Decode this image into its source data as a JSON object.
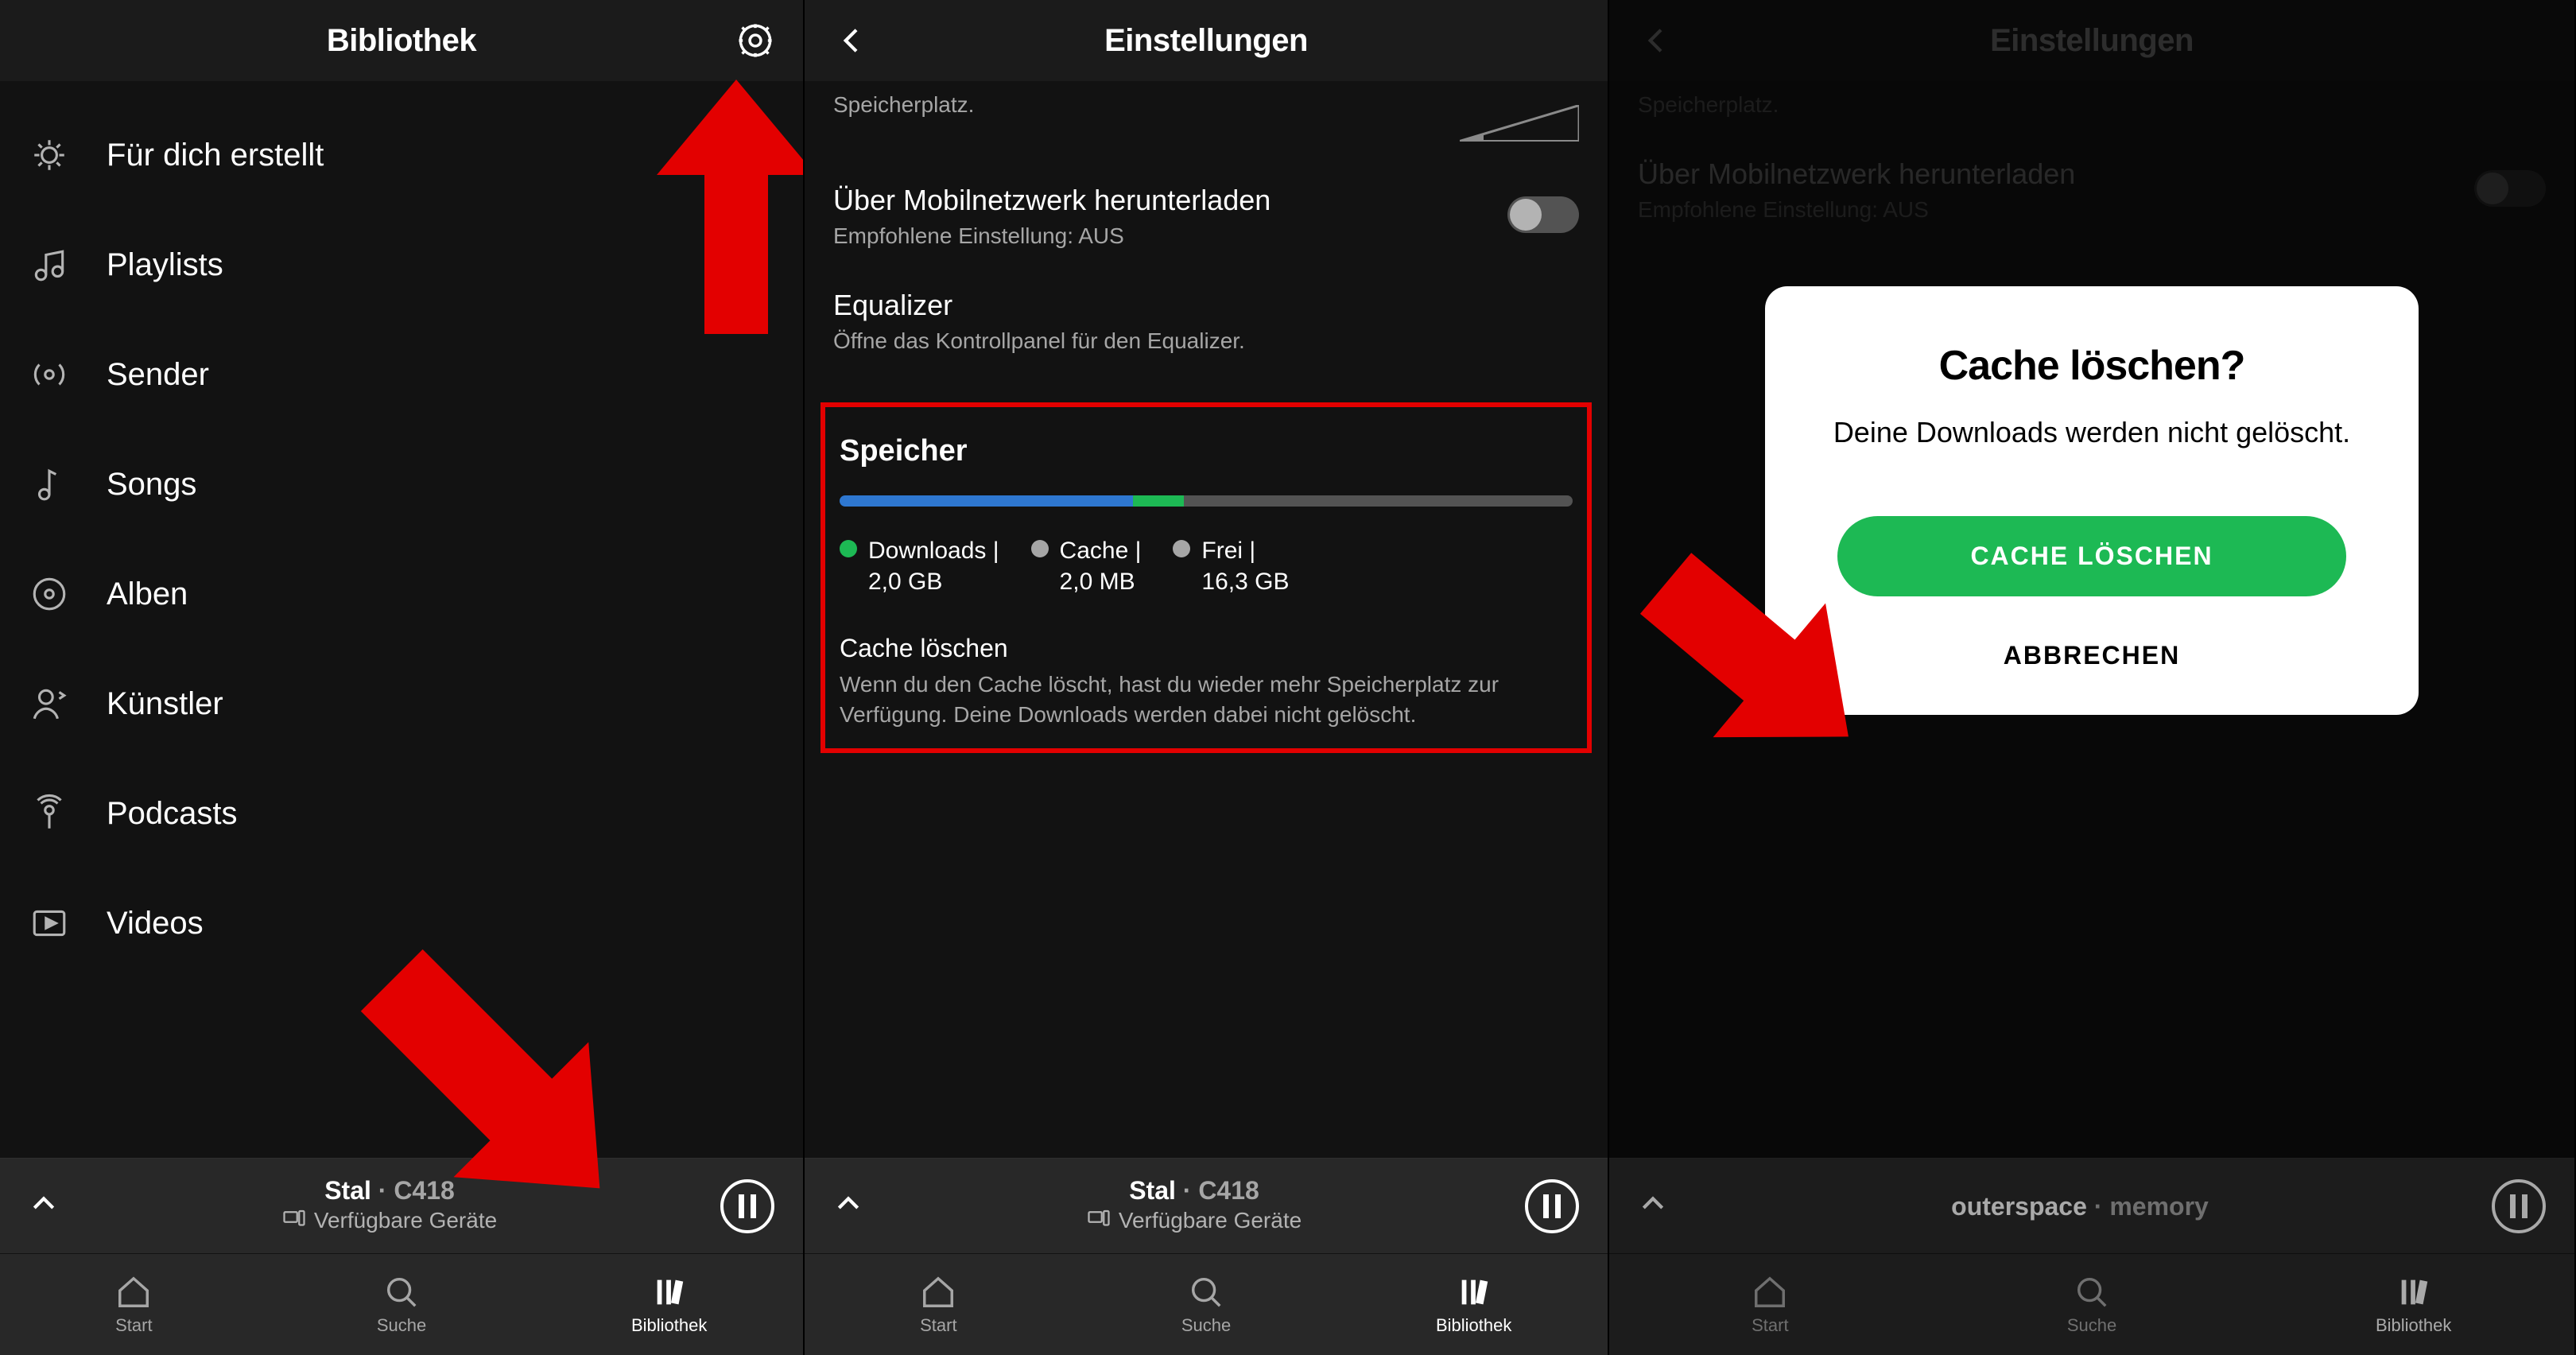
{
  "library": {
    "title": "Bibliothek",
    "items": [
      {
        "icon": "made-for-you",
        "label": "Für dich erstellt"
      },
      {
        "icon": "playlist",
        "label": "Playlists"
      },
      {
        "icon": "radio",
        "label": "Sender"
      },
      {
        "icon": "note",
        "label": "Songs"
      },
      {
        "icon": "album",
        "label": "Alben"
      },
      {
        "icon": "artist",
        "label": "Künstler"
      },
      {
        "icon": "podcast",
        "label": "Podcasts"
      },
      {
        "icon": "video",
        "label": "Videos"
      }
    ]
  },
  "settings": {
    "title": "Einstellungen",
    "storage_hint": "Speicherplatz.",
    "cellular": {
      "title": "Über Mobilnetzwerk herunterladen",
      "sub": "Empfohlene Einstellung: AUS",
      "enabled": false
    },
    "equalizer": {
      "title": "Equalizer",
      "sub": "Öffne das Kontrollpanel für den Equalizer."
    },
    "storage": {
      "heading": "Speicher",
      "legend": {
        "downloads_label": "Downloads |",
        "downloads_value": "2,0 GB",
        "cache_label": "Cache |",
        "cache_value": "2,0 MB",
        "free_label": "Frei |",
        "free_value": "16,3 GB"
      },
      "clear": {
        "title": "Cache löschen",
        "desc": "Wenn du den Cache löscht, hast du wieder mehr Speicherplatz zur Verfügung. Deine Downloads werden dabei nicht gelöscht."
      }
    }
  },
  "dialog": {
    "title": "Cache löschen?",
    "body": "Deine Downloads werden nicht gelöscht.",
    "confirm": "CACHE LÖSCHEN",
    "cancel": "ABBRECHEN"
  },
  "nowplaying": {
    "a": {
      "track": "Stal",
      "sep": " · ",
      "artist": "C418",
      "devices": "Verfügbare Geräte"
    },
    "b": {
      "track": "outerspace",
      "sep": " · ",
      "artist": "memory"
    }
  },
  "tabs": {
    "start": "Start",
    "search": "Suche",
    "library": "Bibliothek"
  }
}
